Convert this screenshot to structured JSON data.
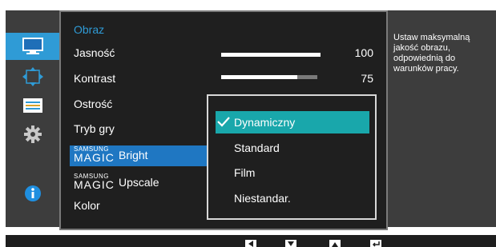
{
  "menu": {
    "title": "Obraz",
    "items": {
      "brightness": "Jasność",
      "contrast": "Kontrast",
      "sharpness": "Ostrość",
      "game_mode": "Tryb gry",
      "magic_bright": {
        "brand": "SAMSUNG",
        "magic": "MAGIC",
        "word": "Bright"
      },
      "magic_upscale": {
        "brand": "SAMSUNG",
        "magic": "MAGIC",
        "word": "Upscale"
      },
      "color": "Kolor"
    },
    "values": {
      "brightness": "100",
      "contrast": "75"
    },
    "levels": {
      "brightness": 1.0,
      "contrast": 0.79
    }
  },
  "dropdown": {
    "selected": "Dynamiczny",
    "options": [
      "Dynamiczny",
      "Standard",
      "Film",
      "Niestandar."
    ]
  },
  "help": "Ustaw maksymalną jakość obrazu, odpowiednią do warunków pracy.",
  "sidebar_icons": [
    "monitor-icon",
    "resize-arrows-icon",
    "settings-sliders-icon",
    "gear-icon",
    "info-icon"
  ],
  "bottom_keys": [
    "left-key-icon",
    "down-key-icon",
    "up-key-icon",
    "enter-key-icon"
  ],
  "colors": {
    "accent_blue": "#1f77c2",
    "teal": "#19a7ab",
    "title_blue": "#2f9bd6"
  }
}
